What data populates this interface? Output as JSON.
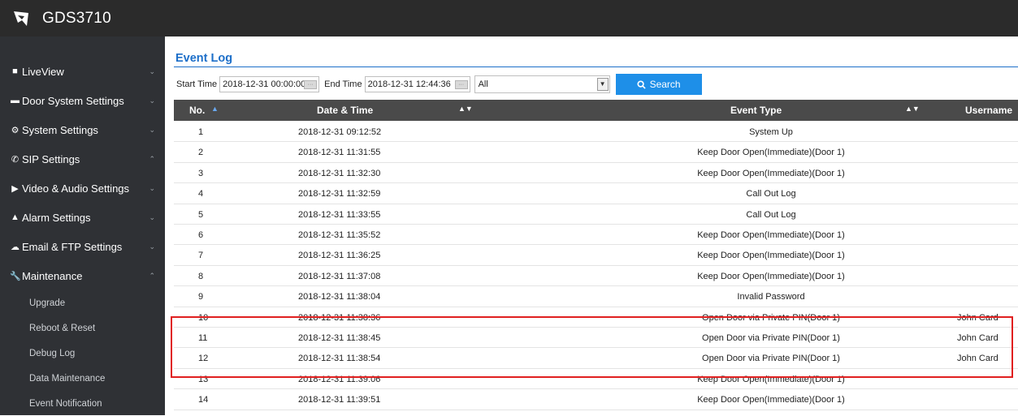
{
  "header": {
    "brand": "GDS3710",
    "logo_icon": "grandstream-logo-icon"
  },
  "sidebar": {
    "items": [
      {
        "label": "LiveView",
        "icon": "camera-icon"
      },
      {
        "label": "Door System Settings",
        "icon": "card-icon"
      },
      {
        "label": "System Settings",
        "icon": "gear-icon"
      },
      {
        "label": "SIP Settings",
        "icon": "phone-icon"
      },
      {
        "label": "Video & Audio Settings",
        "icon": "video-icon"
      },
      {
        "label": "Alarm Settings",
        "icon": "bell-icon"
      },
      {
        "label": "Email & FTP Settings",
        "icon": "cloud-icon"
      },
      {
        "label": "Maintenance",
        "icon": "wrench-icon"
      }
    ],
    "sub_items": [
      "Upgrade",
      "Reboot & Reset",
      "Debug Log",
      "Data Maintenance",
      "Event Notification"
    ]
  },
  "page": {
    "title": "Event Log"
  },
  "filters": {
    "start_label": "Start Time",
    "start_value": "2018-12-31 00:00:00",
    "end_label": "End Time",
    "end_value": "2018-12-31 12:44:36",
    "type_value": "All",
    "search_label": "Search"
  },
  "table": {
    "headers": {
      "no": "No.",
      "datetime": "Date & Time",
      "event": "Event Type",
      "user": "Username"
    },
    "rows": [
      {
        "no": "1",
        "datetime": "2018-12-31 09:12:52",
        "event": "System Up",
        "user": ""
      },
      {
        "no": "2",
        "datetime": "2018-12-31 11:31:55",
        "event": "Keep Door Open(Immediate)(Door 1)",
        "user": ""
      },
      {
        "no": "3",
        "datetime": "2018-12-31 11:32:30",
        "event": "Keep Door Open(Immediate)(Door 1)",
        "user": ""
      },
      {
        "no": "4",
        "datetime": "2018-12-31 11:32:59",
        "event": "Call Out Log",
        "user": ""
      },
      {
        "no": "5",
        "datetime": "2018-12-31 11:33:55",
        "event": "Call Out Log",
        "user": ""
      },
      {
        "no": "6",
        "datetime": "2018-12-31 11:35:52",
        "event": "Keep Door Open(Immediate)(Door 1)",
        "user": ""
      },
      {
        "no": "7",
        "datetime": "2018-12-31 11:36:25",
        "event": "Keep Door Open(Immediate)(Door 1)",
        "user": ""
      },
      {
        "no": "8",
        "datetime": "2018-12-31 11:37:08",
        "event": "Keep Door Open(Immediate)(Door 1)",
        "user": ""
      },
      {
        "no": "9",
        "datetime": "2018-12-31 11:38:04",
        "event": "Invalid Password",
        "user": ""
      },
      {
        "no": "10",
        "datetime": "2018-12-31 11:38:36",
        "event": "Open Door via Private PIN(Door 1)",
        "user": "John Card"
      },
      {
        "no": "11",
        "datetime": "2018-12-31 11:38:45",
        "event": "Open Door via Private PIN(Door 1)",
        "user": "John Card"
      },
      {
        "no": "12",
        "datetime": "2018-12-31 11:38:54",
        "event": "Open Door via Private PIN(Door 1)",
        "user": "John Card"
      },
      {
        "no": "13",
        "datetime": "2018-12-31 11:39:06",
        "event": "Keep Door Open(Immediate)(Door 1)",
        "user": ""
      },
      {
        "no": "14",
        "datetime": "2018-12-31 11:39:51",
        "event": "Keep Door Open(Immediate)(Door 1)",
        "user": ""
      }
    ]
  },
  "colors": {
    "accent": "#1d6fc9",
    "highlight": "#e02020",
    "sidebar": "#2f3135"
  }
}
